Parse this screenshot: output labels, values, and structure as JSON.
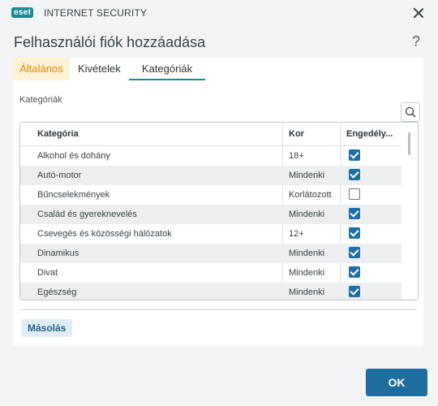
{
  "app": {
    "logo_text": "eset",
    "name": "INTERNET SECURITY"
  },
  "dialog": {
    "title": "Felhasználói fiók hozzáadása",
    "help": "?"
  },
  "tabs": [
    {
      "label": "Általános",
      "state": "highlighted"
    },
    {
      "label": "Kivételek",
      "state": "normal"
    },
    {
      "label": "Kategóriák",
      "state": "active"
    }
  ],
  "section_label": "Kategóriák",
  "table": {
    "headers": {
      "category": "Kategória",
      "age": "Kor",
      "allowed": "Engedély..."
    },
    "rows": [
      {
        "category": "Alkohol és dohány",
        "age": "18+",
        "allowed": true
      },
      {
        "category": "Autó-motor",
        "age": "Mindenki",
        "allowed": true
      },
      {
        "category": "Bűncselekmények",
        "age": "Korlátozott",
        "allowed": false
      },
      {
        "category": "Család és gyereknevelés",
        "age": "Mindenki",
        "allowed": true
      },
      {
        "category": "Csevegés és közösségi hálózatok",
        "age": "12+",
        "allowed": true
      },
      {
        "category": "Dinamikus",
        "age": "Mindenki",
        "allowed": true
      },
      {
        "category": "Divat",
        "age": "Mindenki",
        "allowed": true
      },
      {
        "category": "Egészség",
        "age": "Mindenki",
        "allowed": true
      }
    ]
  },
  "buttons": {
    "copy": "Másolás",
    "ok": "OK"
  },
  "colors": {
    "accent": "#1a8b94",
    "primary": "#1f6d9e",
    "tab_highlight": "#fdf1d6"
  }
}
